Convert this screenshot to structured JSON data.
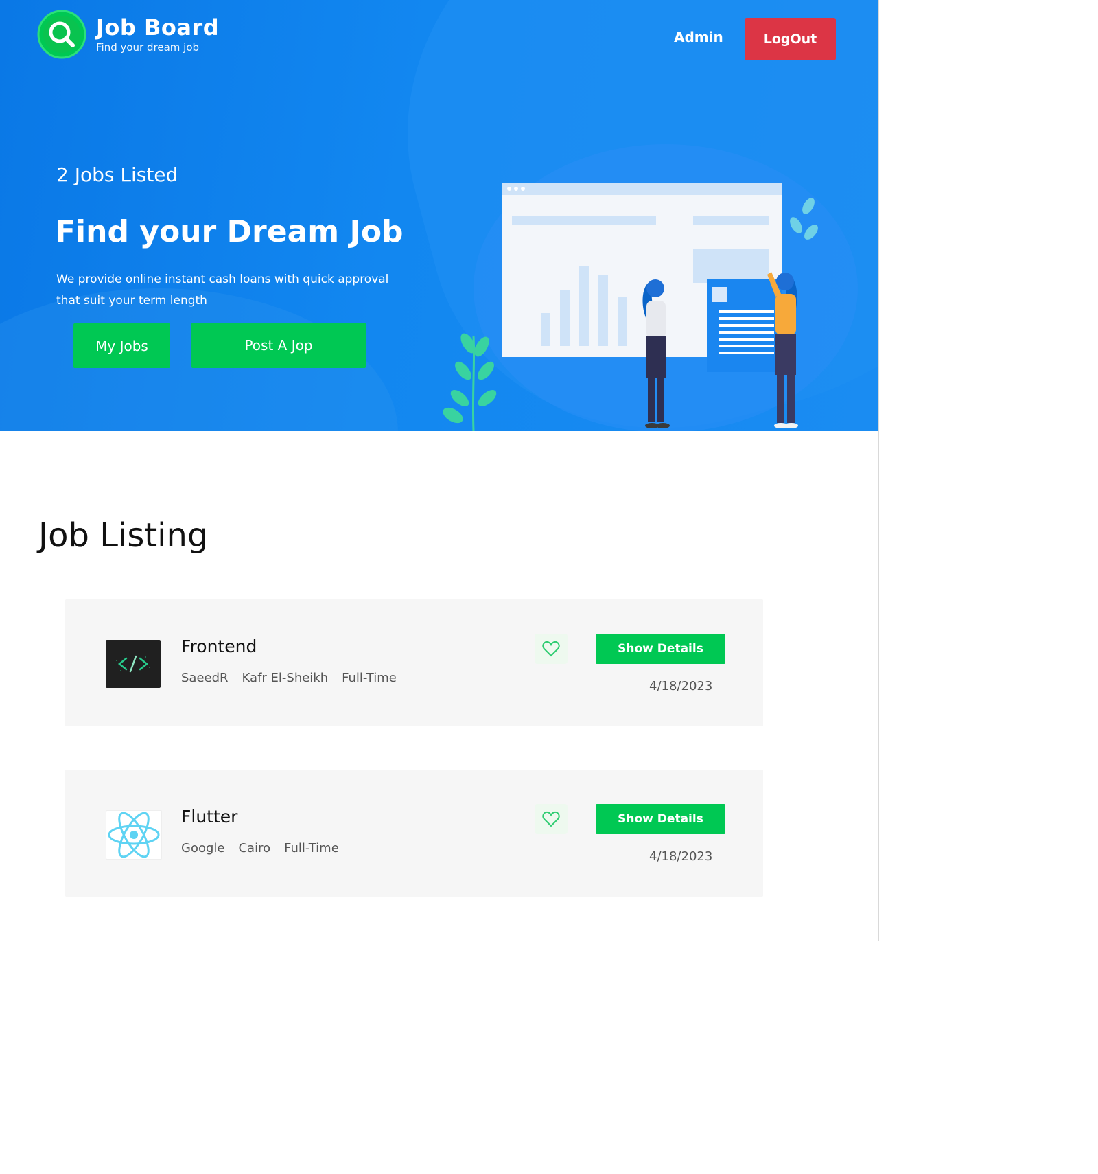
{
  "header": {
    "brand_title": "Job Board",
    "brand_subtitle": "Find your dream job",
    "nav_admin": "Admin",
    "logout_label": "LogOut"
  },
  "hero": {
    "jobs_count_text": "2 Jobs Listed",
    "title": "Find your Dream Job",
    "description": "We provide online instant cash loans with quick approval that suit your term length",
    "my_jobs_label": "My Jobs",
    "post_job_label": "Post A Jop"
  },
  "listing": {
    "title": "Job Listing",
    "jobs": [
      {
        "title": "Frontend",
        "company": "SaeedR",
        "location": "Kafr El-Sheikh",
        "type": "Full-Time",
        "date": "4/18/2023",
        "details_label": "Show Details",
        "logo_icon": "code-icon"
      },
      {
        "title": "Flutter",
        "company": "Google",
        "location": "Cairo",
        "type": "Full-Time",
        "date": "4/18/2023",
        "details_label": "Show Details",
        "logo_icon": "atom-icon"
      }
    ]
  },
  "colors": {
    "hero_blue": "#1287f0",
    "accent_green": "#00c853",
    "logout_red": "#dc3545"
  }
}
